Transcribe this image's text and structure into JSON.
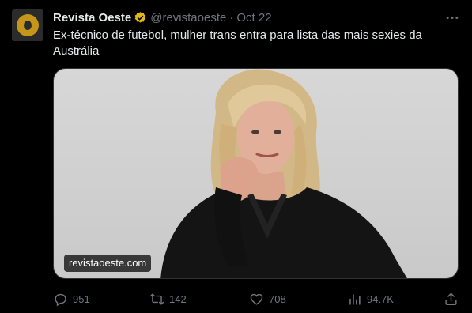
{
  "account": {
    "display_name": "Revista Oeste",
    "handle": "@revistaoeste",
    "separator": "·",
    "date": "Oct 22",
    "verified_icon": "verified-badge-icon"
  },
  "tweet": {
    "text": "Ex-técnico de futebol, mulher trans entra para lista das mais sexies da Austrália"
  },
  "media": {
    "source_label": "revistaoeste.com"
  },
  "actions": {
    "replies": "951",
    "retweets": "142",
    "likes": "708",
    "views": "94.7K"
  },
  "colors": {
    "background": "#000000",
    "text": "#e7e9ea",
    "muted": "#71767b",
    "verified_gold": "#e2b719",
    "avatar_gold": "#c6961b"
  }
}
